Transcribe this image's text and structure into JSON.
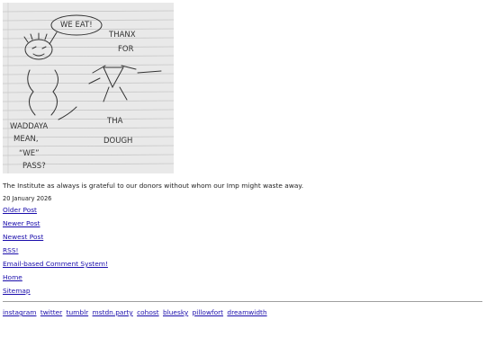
{
  "post": {
    "image_text": {
      "bubble": "WE EAT!",
      "thanks_1": "THANX",
      "thanks_2": "FOR",
      "thanks_3": "THA",
      "thanks_4": "DOUGH",
      "question_1": "WADDAYA",
      "question_2": "MEAN,",
      "question_3": "“WE”",
      "question_4": "PASS?"
    },
    "caption": "The Institute as always is grateful to our donors without whom our Imp might waste away.",
    "date": "20 January 2026"
  },
  "nav": {
    "older": "Older Post",
    "newer": "Newer Post",
    "newest": "Newest Post",
    "rss": "RSS!",
    "comments": "Email-based Comment System!",
    "home": "Home",
    "sitemap": "Sitemap"
  },
  "social": [
    "instagram",
    "twitter",
    "tumblr",
    "mstdn.party",
    "cohost",
    "bluesky",
    "pillowfort",
    "dreamwidth"
  ]
}
